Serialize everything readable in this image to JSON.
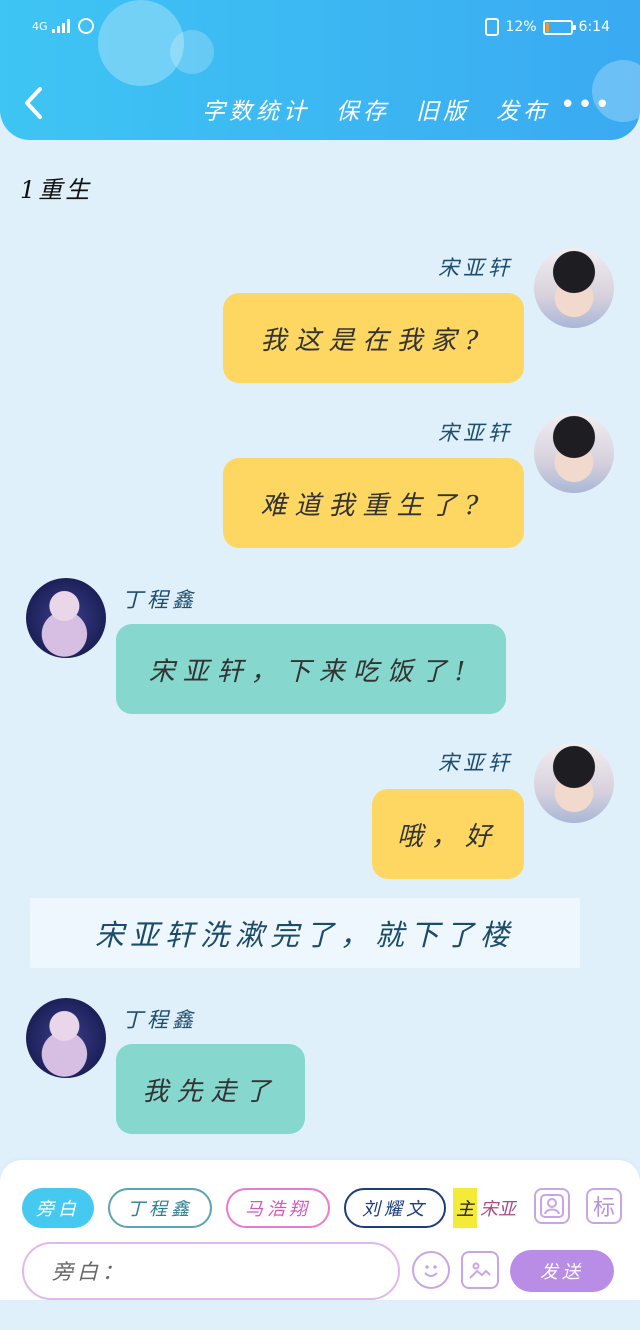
{
  "status_bar": {
    "network": "4G",
    "battery_level": 0.12,
    "battery_text": "12%",
    "time": "6:14"
  },
  "header": {
    "actions": [
      "字数统计",
      "保存",
      "旧版",
      "发布"
    ],
    "more": "•••"
  },
  "chapter_title": "1重生",
  "messages": [
    {
      "sender": "宋亚轩",
      "text": "我这是在我家?"
    },
    {
      "sender": "宋亚轩",
      "text": "难道我重生了?"
    },
    {
      "sender": "丁程鑫",
      "text": "宋亚轩，下来吃饭了!"
    },
    {
      "sender": "宋亚轩",
      "text": "哦，好"
    },
    {
      "narration": "宋亚轩洗漱完了，就下了楼"
    },
    {
      "sender": "丁程鑫",
      "text": "我先走了"
    }
  ],
  "composer": {
    "roles": [
      "旁白",
      "丁程鑫",
      "马浩翔",
      "刘耀文"
    ],
    "role_partial_highlight": "主",
    "role_partial_rest": "宋亚",
    "square_btn_2": "标",
    "input_placeholder": "旁白：",
    "send_label": "发送"
  },
  "colors": {
    "header": "#3ab8f2",
    "bubble_self": "#fdd762",
    "bubble_other": "#86d7cd",
    "send": "#b98ce6"
  }
}
